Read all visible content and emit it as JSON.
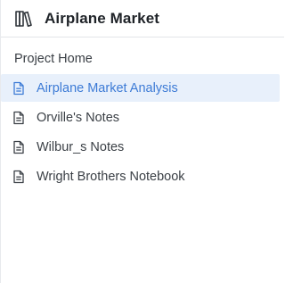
{
  "header": {
    "logo_icon": "bookshelf-icon",
    "title": "Airplane Market"
  },
  "project_home": "Project Home",
  "nav": {
    "items": [
      {
        "label": "Airplane Market Analysis",
        "icon": "document-icon",
        "active": true
      },
      {
        "label": "Orville's Notes",
        "icon": "document-icon",
        "active": false
      },
      {
        "label": "Wilbur_s Notes",
        "icon": "document-icon",
        "active": false
      },
      {
        "label": "Wright Brothers Notebook",
        "icon": "document-icon",
        "active": false
      }
    ]
  },
  "colors": {
    "active_bg": "#e8f0fb",
    "active_text": "#3d7bd6",
    "text": "#3b4046",
    "divider": "#e3e5e8"
  }
}
